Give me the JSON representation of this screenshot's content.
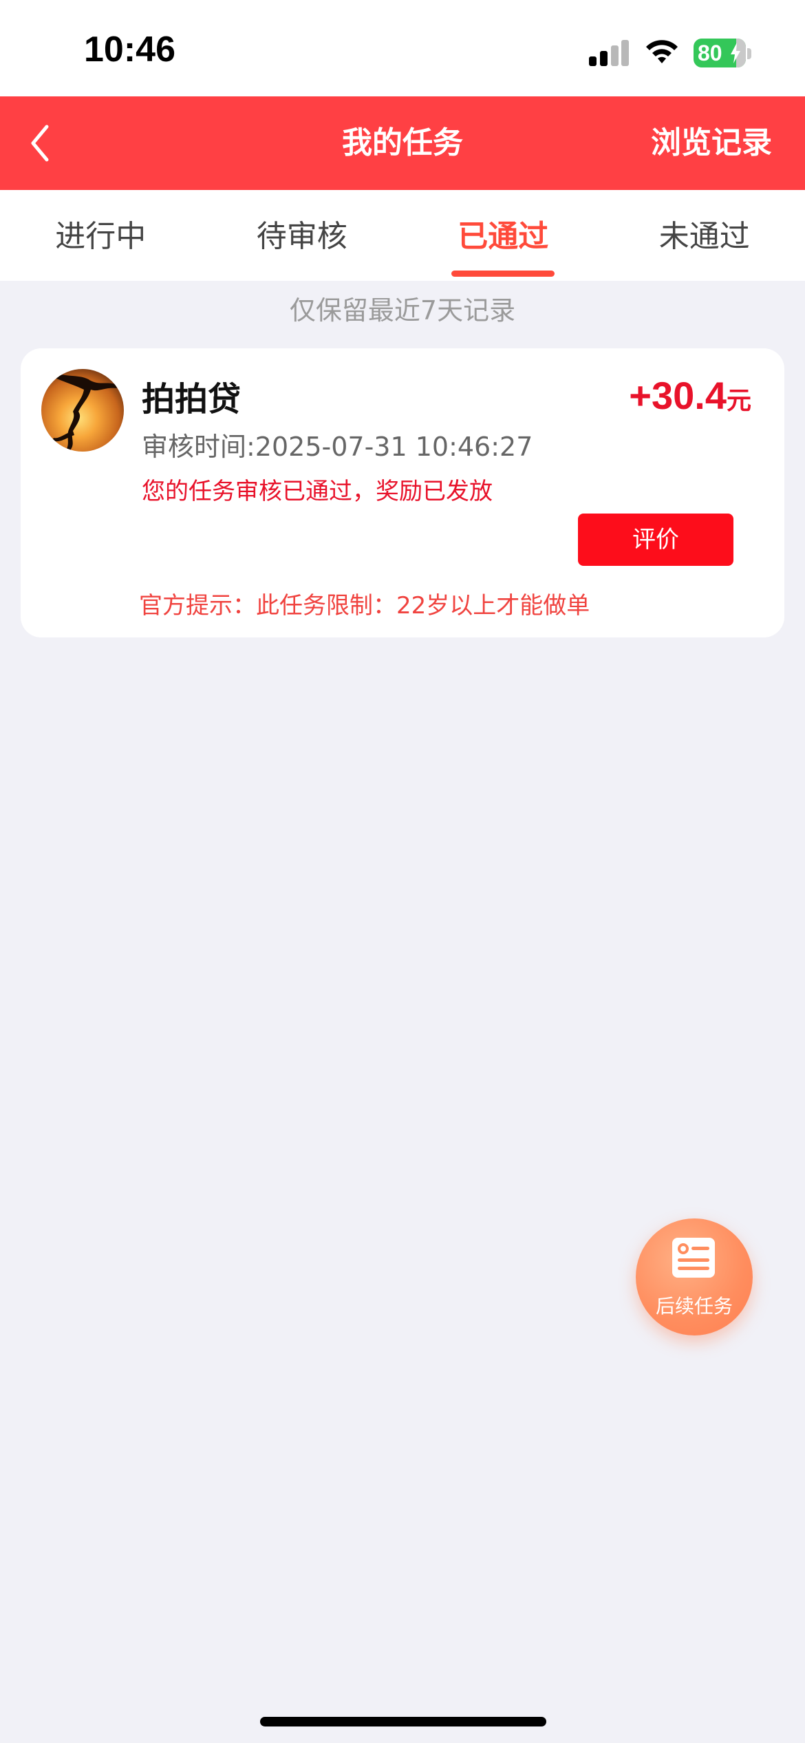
{
  "status_bar": {
    "time": "10:46",
    "battery_level": "80"
  },
  "header": {
    "title": "我的任务",
    "action_label": "浏览记录"
  },
  "tabs": [
    {
      "label": "进行中",
      "active": false
    },
    {
      "label": "待审核",
      "active": false
    },
    {
      "label": "已通过",
      "active": true
    },
    {
      "label": "未通过",
      "active": false
    }
  ],
  "notice": "仅保留最近7天记录",
  "task": {
    "name": "拍拍贷",
    "reward_amount": "+30.4",
    "reward_unit": "元",
    "review_time": "审核时间:2025-07-31 10:46:27",
    "status_message": "您的任务审核已通过，奖励已发放",
    "rate_button_label": "评价",
    "official_tip": "官方提示：此任务限制：22岁以上才能做单"
  },
  "fab": {
    "label": "后续任务"
  },
  "colors": {
    "header_bg": "#ff4044",
    "accent_red": "#e8122a",
    "tab_active": "#ff4a3a",
    "page_bg": "#f1f1f7",
    "fab_orange": "#ff8d5e"
  }
}
